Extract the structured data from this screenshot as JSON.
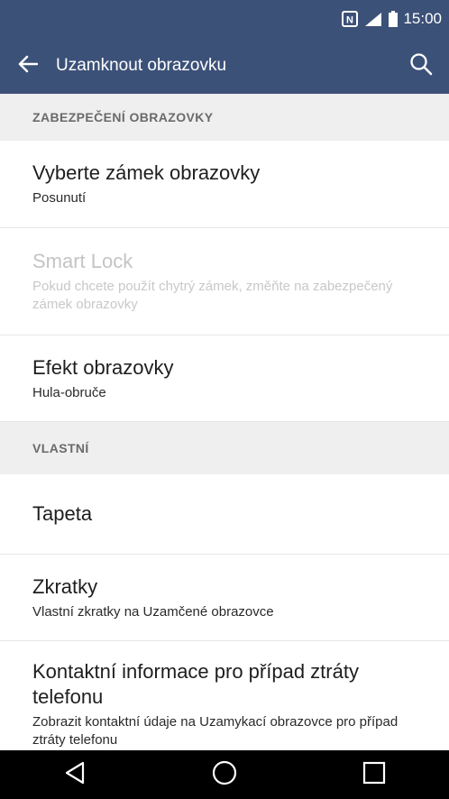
{
  "status_bar": {
    "time": "15:00",
    "icons": [
      "nfc-icon",
      "signal-icon",
      "battery-icon"
    ]
  },
  "app_bar": {
    "title": "Uzamknout obrazovku",
    "back_icon": "back-arrow-icon",
    "search_icon": "search-icon"
  },
  "sections": [
    {
      "header": "ZABEZPEČENÍ OBRAZOVKY",
      "items": [
        {
          "title": "Vyberte zámek obrazovky",
          "subtitle": "Posunutí",
          "enabled": true
        },
        {
          "title": "Smart Lock",
          "subtitle": "Pokud chcete použít chytrý zámek, změňte na zabezpečený zámek obrazovky",
          "enabled": false
        },
        {
          "title": "Efekt obrazovky",
          "subtitle": "Hula-obruče",
          "enabled": true
        }
      ]
    },
    {
      "header": "VLASTNÍ",
      "items": [
        {
          "title": "Tapeta",
          "enabled": true
        },
        {
          "title": "Zkratky",
          "subtitle": "Vlastní zkratky na Uzamčené obrazovce",
          "enabled": true
        },
        {
          "title": "Kontaktní informace pro případ ztráty telefonu",
          "subtitle": "Zobrazit kontaktní údaje na Uzamykací obrazovce pro případ ztráty telefonu",
          "enabled": true
        }
      ]
    }
  ],
  "nav_bar": {
    "buttons": [
      "back-triangle-icon",
      "home-circle-icon",
      "recents-square-icon"
    ]
  },
  "colors": {
    "app_bar": "#3c5178",
    "section_header_bg": "#efefef",
    "disabled_text": "#c4c4c4"
  }
}
